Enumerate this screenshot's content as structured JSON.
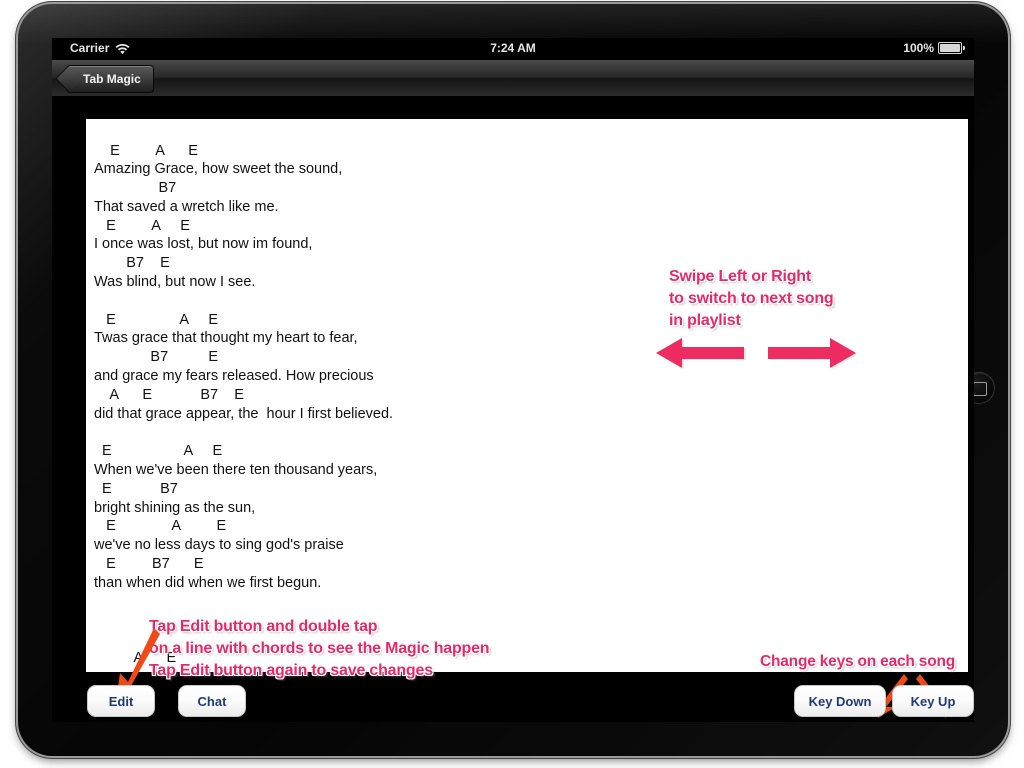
{
  "device": {
    "name": "ipad-landscape",
    "home_button_icon": "home-button-icon"
  },
  "status_bar": {
    "carrier": "Carrier",
    "wifi_icon": "wifi-icon",
    "time": "7:24 AM",
    "battery_percent": "100%",
    "battery_icon": "battery-full-icon"
  },
  "toolbar": {
    "back_button_label": "Tab Magic"
  },
  "song": {
    "title_hidden": "Amazing Grace",
    "text": "    E         A      E\nAmazing Grace, how sweet the sound,\n                B7\nThat saved a wretch like me.\n   E         A     E\nI once was lost, but now im found,\n        B7    E\nWas blind, but now I see.\n\n   E                A     E\nTwas grace that thought my heart to fear,\n              B7          E\nand grace my fears released. How precious\n    A      E            B7    E\ndid that grace appear, the  hour I first believed.\n\n  E                  A     E\nWhen we've been there ten thousand years,\n  E            B7\nbright shining as the sun,\n   E              A         E\nwe've no less days to sing god's praise\n   E         B7      E\nthan when did when we first begun.\n\n\n\n          A      E"
  },
  "annotations": {
    "swipe_note": "Swipe Left or Right\nto switch to next song\nin playlist",
    "edit_note": "Tap Edit button and double tap\non a line with chords to see the Magic happen\nTap Edit button again to save changes",
    "keys_note": "Change keys on each song",
    "arrow_left_icon": "arrow-left-pink-icon",
    "arrow_right_icon": "arrow-right-pink-icon",
    "arrow_edit_icon": "arrow-down-left-orange-icon",
    "arrow_keydown_icon": "arrow-down-left-orange-icon",
    "arrow_keyup_icon": "arrow-down-right-orange-icon"
  },
  "buttons": {
    "edit": "Edit",
    "chat": "Chat",
    "key_down": "Key Down",
    "key_up": "Key Up"
  },
  "colors": {
    "annotation_pink": "#e52a69",
    "annotation_arrow_pink": "#ee2c62",
    "annotation_arrow_orange": "#f04a18",
    "button_text_blue": "#1f3a77",
    "sheet_background": "#ffffff",
    "device_black": "#050505"
  }
}
